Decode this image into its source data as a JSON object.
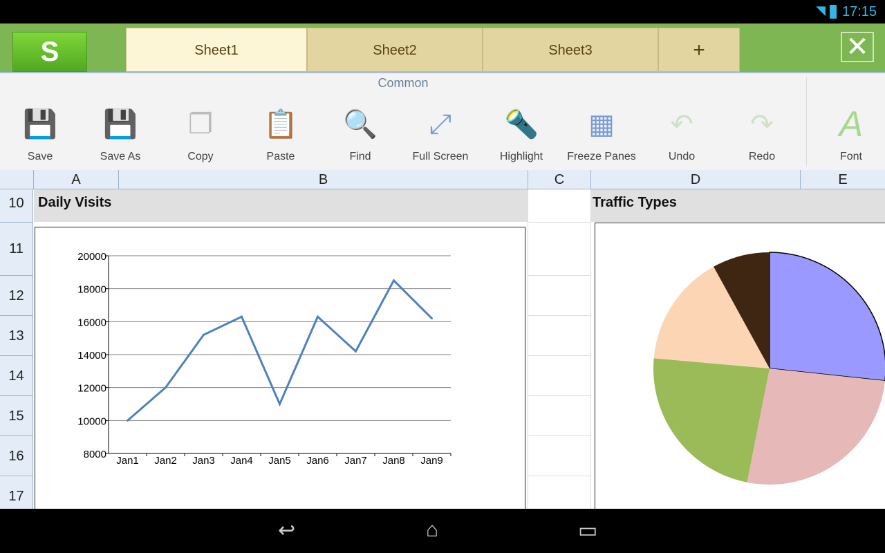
{
  "status": {
    "time": "17:15"
  },
  "app": {
    "logo": "S",
    "tabs": [
      {
        "label": "Sheet1",
        "active": true
      },
      {
        "label": "Sheet2"
      },
      {
        "label": "Sheet3"
      }
    ],
    "add_tab": "+",
    "close": "✕"
  },
  "ribbon": {
    "group": "Common",
    "tools": [
      {
        "label": "Save",
        "icon": "save-icon"
      },
      {
        "label": "Save As",
        "icon": "save-as-icon"
      },
      {
        "label": "Copy",
        "icon": "copy-icon"
      },
      {
        "label": "Paste",
        "icon": "paste-icon"
      },
      {
        "label": "Find",
        "icon": "find-icon"
      },
      {
        "label": "Full Screen",
        "icon": "full-screen-icon"
      },
      {
        "label": "Highlight",
        "icon": "highlight-icon"
      },
      {
        "label": "Freeze Panes",
        "icon": "freeze-panes-icon"
      },
      {
        "label": "Undo",
        "icon": "undo-icon"
      },
      {
        "label": "Redo",
        "icon": "redo-icon"
      },
      {
        "label": "Font",
        "icon": "font-icon"
      }
    ]
  },
  "grid": {
    "columns": [
      "A",
      "B",
      "C",
      "D",
      "E"
    ],
    "rows": [
      "10",
      "11",
      "12",
      "13",
      "14",
      "15",
      "16",
      "17"
    ],
    "cells": {
      "A10": "Daily Visits",
      "D10": "Traffic Types"
    }
  },
  "chart_data": [
    {
      "type": "line",
      "title": "Daily Visits",
      "categories": [
        "Jan1",
        "Jan2",
        "Jan3",
        "Jan4",
        "Jan5",
        "Jan6",
        "Jan7",
        "Jan8",
        "Jan9"
      ],
      "values": [
        10000,
        12000,
        15200,
        16300,
        11000,
        16300,
        14200,
        18500,
        16200
      ],
      "ylim": [
        8000,
        20000
      ],
      "yticks": [
        "8000",
        "10000",
        "12000",
        "14000",
        "16000",
        "18000",
        "20000"
      ],
      "grid": true,
      "color": "#4f81bd"
    },
    {
      "type": "pie",
      "title": "Traffic Types",
      "values": [
        26.7,
        26.4,
        23.3,
        15.6,
        8.0
      ],
      "colors": [
        "#9999ff",
        "#e6b8b7",
        "#9bbb59",
        "#fcd5b5",
        "#3f2613"
      ]
    }
  ]
}
